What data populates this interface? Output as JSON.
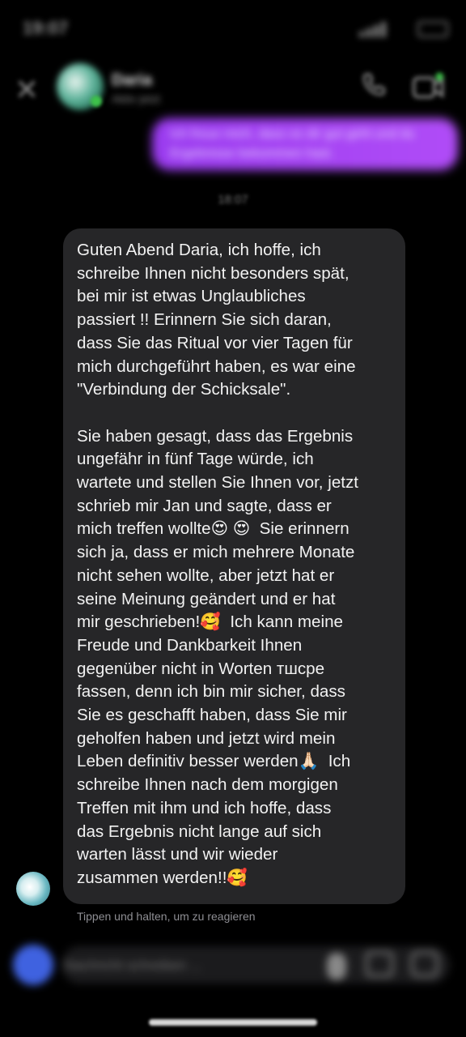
{
  "status_bar": {
    "time": "19:07"
  },
  "header": {
    "contact_name": "Daria",
    "contact_status": "Aktiv jetzt"
  },
  "messages": {
    "sent_text": "Ich freue mich, dass es dir gut geht und du Ergebnisse bekommen hast.",
    "timestamp": "18:07",
    "received_text": "Guten Abend Daria, ich hoffe, ich\nschreibe Ihnen nicht besonders spät,\nbei mir ist etwas Unglaubliches\npassiert !! Erinnern Sie sich daran,\ndass Sie das Ritual vor vier Tagen für\nmich durchgeführt haben, es war eine\n\"Verbindung der Schicksale\".\n\nSie haben gesagt, dass das Ergebnis\nungefähr in fünf Tage würde, ich\nwartete und stellen Sie Ihnen vor, jetzt\nschrieb mir Jan und sagte, dass er\nmich treffen wollte😍 😍  Sie erinnern\nsich ja, dass er mich mehrere Monate\nnicht sehen wollte, aber jetzt hat er\nseine Meinung geändert und er hat\nmir geschrieben!🥰  Ich kann meine\nFreude und Dankbarkeit Ihnen\ngegenüber nicht in Worten тшсре\nfassen, denn ich bin mir sicher, dass\nSie es geschafft haben, dass Sie mir\ngeholfen haben und jetzt wird mein\nLeben definitiv besser werden🙏🏻  Ich\nschreibe Ihnen nach dem morgigen\nTreffen mit ihm und ich hoffe, dass\ndas Ergebnis nicht lange auf sich\nwarten lässt und wir wieder\nzusammen werden!!🥰",
    "react_hint": "Tippen und halten, um zu reagieren"
  },
  "composer": {
    "placeholder": "Nachricht schreiben ..."
  },
  "colors": {
    "background": "#000000",
    "sent_bubble": "#a943f5",
    "received_bubble": "#262628",
    "online": "#3ec24a",
    "camera_button": "#3f62e0"
  },
  "icons": [
    "close-icon",
    "call-icon",
    "video-icon",
    "camera-icon",
    "mic-icon",
    "gallery-icon",
    "sticker-icon"
  ]
}
